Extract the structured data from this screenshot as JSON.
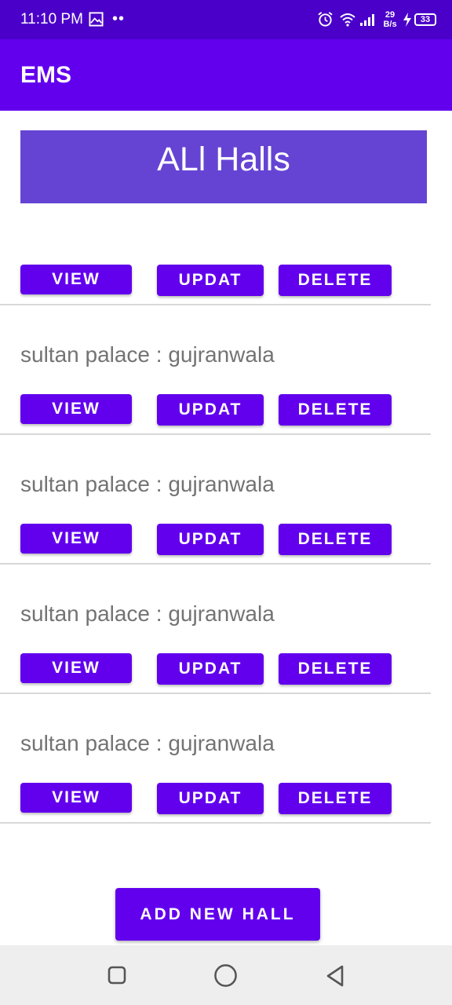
{
  "status_bar": {
    "time": "11:10 PM",
    "dots": "••",
    "net_speed_top": "29",
    "net_speed_bottom": "B/s",
    "battery": "33",
    "icons": [
      "gallery-icon",
      "alarm-icon",
      "wifi-icon",
      "signal-icon",
      "charging-icon",
      "battery-icon"
    ]
  },
  "app_bar": {
    "title": "EMS"
  },
  "header": {
    "title": "ALl Halls"
  },
  "halls": [
    {
      "label": "",
      "view": "VIEW",
      "update": "UPDAT",
      "delete": "DELETE"
    },
    {
      "label": "sultan palace : gujranwala",
      "view": "VIEW",
      "update": "UPDAT",
      "delete": "DELETE"
    },
    {
      "label": "sultan palace : gujranwala",
      "view": "VIEW",
      "update": "UPDAT",
      "delete": "DELETE"
    },
    {
      "label": "sultan palace : gujranwala",
      "view": "VIEW",
      "update": "UPDAT",
      "delete": "DELETE"
    },
    {
      "label": "sultan palace : gujranwala",
      "view": "VIEW",
      "update": "UPDAT",
      "delete": "DELETE"
    }
  ],
  "add_button": {
    "label": "ADD NEW HALL"
  },
  "nav_bar": {
    "icons": [
      "recents-icon",
      "home-icon",
      "back-icon"
    ]
  },
  "colors": {
    "status_bar": "#4a00c9",
    "primary": "#6200ee",
    "header_banner": "#6544d4",
    "label_text": "#737373",
    "divider": "#d8d8d8",
    "nav_bar": "#eeeeee"
  }
}
